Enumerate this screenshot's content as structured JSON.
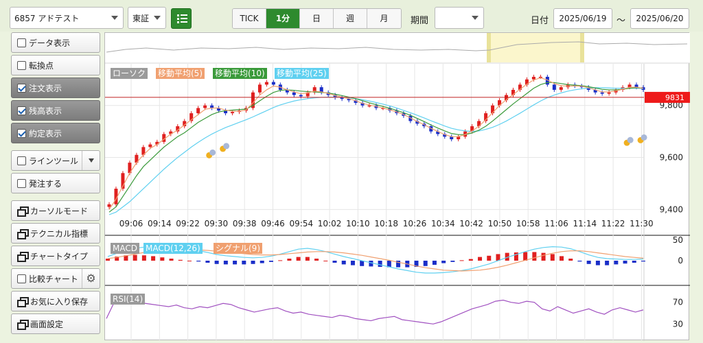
{
  "toolbar": {
    "symbol": "6857 アドテスト",
    "market": "東証",
    "intervals": [
      "TICK",
      "1分",
      "日",
      "週",
      "月"
    ],
    "active_interval": "1分",
    "period_label": "期間",
    "period_value": "",
    "date_label": "日付",
    "date_from": "2025/06/19",
    "date_sep": "〜",
    "date_to": "2025/06/20"
  },
  "sidebar": {
    "items": [
      {
        "label": "データ表示",
        "kind": "checkbox",
        "checked": false,
        "active": false
      },
      {
        "label": "転換点",
        "kind": "checkbox",
        "checked": false,
        "active": false
      },
      {
        "label": "注文表示",
        "kind": "checkbox",
        "checked": true,
        "active": true
      },
      {
        "label": "残高表示",
        "kind": "checkbox",
        "checked": true,
        "active": true
      },
      {
        "label": "約定表示",
        "kind": "checkbox",
        "checked": true,
        "active": true
      },
      {
        "label": "ラインツール",
        "kind": "checkbox-dropdown",
        "checked": false,
        "active": false
      },
      {
        "label": "発注する",
        "kind": "checkbox",
        "checked": false,
        "active": false
      },
      {
        "label": "カーソルモード",
        "kind": "window",
        "active": false
      },
      {
        "label": "テクニカル指標",
        "kind": "window",
        "active": false
      },
      {
        "label": "チャートタイプ",
        "kind": "window",
        "active": false
      },
      {
        "label": "比較チャート",
        "kind": "checkbox-gear",
        "checked": false,
        "active": false
      },
      {
        "label": "お気に入り保存",
        "kind": "window",
        "active": false
      },
      {
        "label": "画面設定",
        "kind": "window",
        "active": false
      }
    ]
  },
  "legend": {
    "candle": "ローソク",
    "ma5": "移動平均(5)",
    "ma10": "移動平均(10)",
    "ma25": "移動平均(25)",
    "macd": "MACD",
    "macd_line": "MACD(12,26)",
    "signal": "シグナル(9)",
    "rsi": "RSI(14)"
  },
  "colors": {
    "up": "#e02020",
    "down": "#1a2ec8",
    "ma5": "#f0a070",
    "ma10": "#3a9a3a",
    "ma25": "#5fd0f0",
    "rsi": "#a050c0",
    "price_line": "#c02020",
    "accent": "#2e8a2e"
  },
  "current_price": "9831",
  "chart_data": [
    {
      "type": "candlestick",
      "title": "",
      "x_ticks": [
        "09:06",
        "09:14",
        "09:22",
        "09:30",
        "09:38",
        "09:46",
        "09:54",
        "10:02",
        "10:10",
        "10:18",
        "10:26",
        "10:34",
        "10:42",
        "10:50",
        "10:58",
        "11:06",
        "11:14",
        "11:22",
        "11:30"
      ],
      "y_ticks": [
        "9,800",
        "9,600",
        "9,400"
      ],
      "ylim": [
        9380,
        9960
      ],
      "close": [
        9420,
        9480,
        9540,
        9580,
        9610,
        9640,
        9650,
        9660,
        9690,
        9700,
        9720,
        9740,
        9770,
        9790,
        9800,
        9790,
        9780,
        9770,
        9775,
        9780,
        9790,
        9850,
        9880,
        9890,
        9880,
        9860,
        9850,
        9840,
        9835,
        9850,
        9870,
        9850,
        9840,
        9830,
        9825,
        9820,
        9810,
        9800,
        9800,
        9790,
        9790,
        9780,
        9770,
        9760,
        9740,
        9730,
        9720,
        9700,
        9690,
        9680,
        9670,
        9680,
        9700,
        9720,
        9740,
        9770,
        9800,
        9820,
        9840,
        9860,
        9880,
        9900,
        9910,
        9910,
        9880,
        9860,
        9870,
        9880,
        9875,
        9870,
        9860,
        9850,
        9845,
        9850,
        9860,
        9870,
        9880,
        9870,
        9860
      ],
      "ma5": [
        9400,
        9440,
        9490,
        9540,
        9580,
        9610,
        9635,
        9650,
        9670,
        9690,
        9705,
        9725,
        9745,
        9765,
        9785,
        9790,
        9790,
        9782,
        9778,
        9777,
        9783,
        9810,
        9840,
        9860,
        9875,
        9870,
        9860,
        9852,
        9845,
        9848,
        9855,
        9852,
        9846,
        9838,
        9832,
        9826,
        9818,
        9808,
        9802,
        9796,
        9790,
        9783,
        9775,
        9765,
        9752,
        9738,
        9726,
        9712,
        9700,
        9688,
        9680,
        9680,
        9688,
        9702,
        9720,
        9745,
        9772,
        9800,
        9822,
        9842,
        9862,
        9882,
        9898,
        9906,
        9898,
        9884,
        9876,
        9874,
        9875,
        9874,
        9868,
        9860,
        9852,
        9852,
        9856,
        9862,
        9870,
        9870,
        9866
      ],
      "ma10": [
        9390,
        9410,
        9450,
        9490,
        9530,
        9565,
        9590,
        9615,
        9640,
        9660,
        9680,
        9695,
        9715,
        9735,
        9750,
        9765,
        9775,
        9780,
        9782,
        9784,
        9786,
        9800,
        9818,
        9835,
        9850,
        9858,
        9860,
        9858,
        9855,
        9853,
        9852,
        9850,
        9848,
        9843,
        9838,
        9832,
        9826,
        9818,
        9810,
        9803,
        9796,
        9789,
        9781,
        9772,
        9762,
        9750,
        9738,
        9725,
        9713,
        9702,
        9692,
        9688,
        9688,
        9694,
        9705,
        9720,
        9740,
        9762,
        9784,
        9806,
        9826,
        9846,
        9866,
        9880,
        9888,
        9888,
        9884,
        9880,
        9878,
        9876,
        9872,
        9867,
        9862,
        9860,
        9860,
        9862,
        9866,
        9868,
        9866
      ],
      "ma25": [
        9380,
        9390,
        9410,
        9430,
        9455,
        9480,
        9505,
        9530,
        9555,
        9578,
        9600,
        9620,
        9640,
        9658,
        9675,
        9690,
        9703,
        9715,
        9725,
        9735,
        9745,
        9756,
        9768,
        9780,
        9792,
        9802,
        9810,
        9817,
        9822,
        9826,
        9829,
        9831,
        9832,
        9832,
        9831,
        9829,
        9826,
        9822,
        9817,
        9811,
        9805,
        9798,
        9790,
        9781,
        9772,
        9762,
        9752,
        9741,
        9731,
        9721,
        9712,
        9706,
        9702,
        9700,
        9702,
        9708,
        9716,
        9727,
        9740,
        9755,
        9770,
        9786,
        9802,
        9817,
        9830,
        9840,
        9848,
        9855,
        9860,
        9864,
        9867,
        9868,
        9868,
        9867,
        9866,
        9866,
        9866,
        9866,
        9865
      ]
    },
    {
      "type": "macd",
      "title": "",
      "y_ticks": [
        "50",
        "0"
      ],
      "ylim": [
        -60,
        60
      ],
      "macd": [
        10,
        18,
        25,
        30,
        33,
        34,
        33,
        31,
        29,
        27,
        24,
        20,
        15,
        12,
        10,
        8,
        7,
        8,
        11,
        16,
        22,
        28,
        30,
        27,
        22,
        16,
        10,
        5,
        0,
        -5,
        -10,
        -15,
        -20,
        -24,
        -28,
        -30,
        -30,
        -29,
        -27,
        -24,
        -20,
        -14,
        -8,
        0,
        8,
        15,
        22,
        28,
        32,
        34,
        33,
        29,
        22,
        14,
        8,
        5,
        4,
        3,
        3,
        4
      ],
      "signal": [
        5,
        8,
        12,
        16,
        20,
        23,
        25,
        26,
        27,
        27,
        26,
        25,
        23,
        21,
        19,
        17,
        15,
        14,
        14,
        15,
        17,
        19,
        21,
        22,
        22,
        21,
        19,
        16,
        13,
        9,
        5,
        1,
        -4,
        -8,
        -13,
        -17,
        -20,
        -23,
        -24,
        -25,
        -24,
        -23,
        -20,
        -16,
        -11,
        -5,
        1,
        7,
        13,
        18,
        22,
        24,
        24,
        22,
        19,
        16,
        13,
        10,
        8,
        6
      ]
    },
    {
      "type": "line",
      "title": "",
      "y_ticks": [
        "70",
        "30"
      ],
      "ylim": [
        0,
        100
      ],
      "values": [
        40,
        70,
        72,
        74,
        70,
        68,
        66,
        64,
        62,
        65,
        60,
        58,
        62,
        60,
        64,
        68,
        66,
        60,
        56,
        52,
        55,
        58,
        60,
        54,
        50,
        52,
        48,
        46,
        44,
        42,
        46,
        44,
        40,
        38,
        36,
        40,
        42,
        44,
        38,
        36,
        34,
        32,
        30,
        34,
        40,
        46,
        52,
        58,
        62,
        66,
        72,
        74,
        70,
        68,
        72,
        70,
        58,
        54,
        62,
        56,
        50,
        54,
        58,
        52,
        48,
        56,
        60,
        56,
        52,
        56
      ]
    }
  ]
}
